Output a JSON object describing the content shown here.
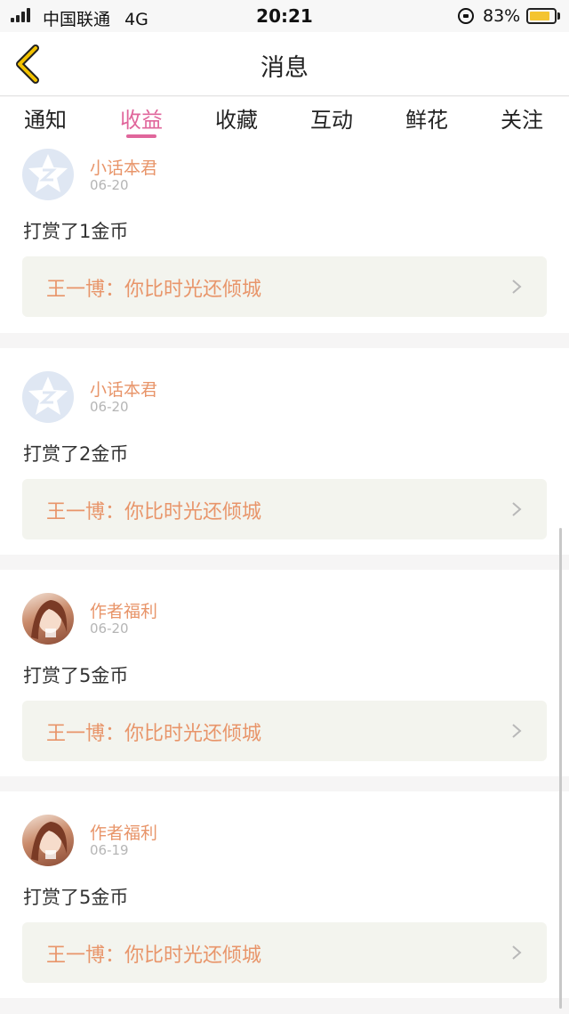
{
  "status": {
    "carrier": "中国联通",
    "network": "4G",
    "time": "20:21",
    "battery_pct": "83%",
    "battery_level": 0.83,
    "battery_color": "#f4c430"
  },
  "nav": {
    "back_icon": "chevron-left-icon",
    "title": "消息",
    "accent": "#f2c200"
  },
  "tabs": [
    {
      "label": "通知",
      "active": false
    },
    {
      "label": "收益",
      "active": true
    },
    {
      "label": "收藏",
      "active": false
    },
    {
      "label": "互动",
      "active": false
    },
    {
      "label": "鲜花",
      "active": false
    },
    {
      "label": "关注",
      "active": false
    }
  ],
  "colors": {
    "active_tab": "#e0669b",
    "username": "#e8956a",
    "book_title": "#e8956a",
    "book_box": "#f3f4ee"
  },
  "messages": [
    {
      "user": "小话本君",
      "avatar": "star-avatar-icon",
      "date": "06-20",
      "text": "打赏了1金币",
      "book": "王一博：你比时光还倾城"
    },
    {
      "user": "小话本君",
      "avatar": "star-avatar-icon",
      "date": "06-20",
      "text": "打赏了2金币",
      "book": "王一博：你比时光还倾城"
    },
    {
      "user": "作者福利",
      "avatar": "anime-girl-avatar",
      "date": "06-20",
      "text": "打赏了5金币",
      "book": "王一博：你比时光还倾城"
    },
    {
      "user": "作者福利",
      "avatar": "anime-girl-avatar",
      "date": "06-19",
      "text": "打赏了5金币",
      "book": "王一博：你比时光还倾城"
    }
  ]
}
